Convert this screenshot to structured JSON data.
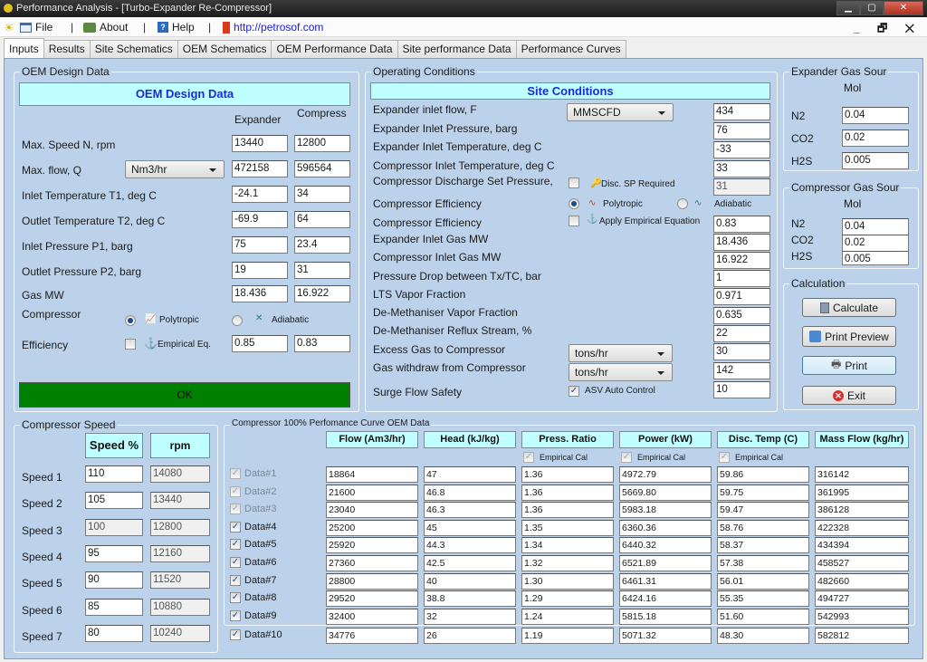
{
  "window": {
    "title": "Performance Analysis - [Turbo-Expander Re-Compressor]"
  },
  "menu": {
    "items": [
      {
        "label": "File",
        "icon": "window-icon"
      },
      {
        "label": "About",
        "icon": "about-icon"
      },
      {
        "label": "Help",
        "icon": "help-icon"
      },
      {
        "label": "http://petrosof.com",
        "icon": "bookmark-icon"
      }
    ],
    "separator": "|"
  },
  "tabs": [
    "Inputs",
    "Results",
    "Site Schematics",
    "OEM Schematics",
    "OEM Performance Data",
    "Site performance Data",
    "Performance Curves"
  ],
  "active_tab": "Inputs",
  "oem": {
    "group_label": "OEM Design Data",
    "header": "OEM Design Data",
    "col_expander": "Expander",
    "col_compress": "Compress",
    "flow_unit": "Nm3/hr",
    "rows": [
      {
        "label": "Max. Speed N, rpm",
        "expander": "13440",
        "compress": "12800"
      },
      {
        "label": "Max. flow, Q",
        "expander": "472158",
        "compress": "596564"
      },
      {
        "label": "Inlet Temperature T1, deg C",
        "expander": "-24.1",
        "compress": "34"
      },
      {
        "label": "Outlet Temperature T2, deg C",
        "expander": "-69.9",
        "compress": "64"
      },
      {
        "label": "Inlet Pressure P1, barg",
        "expander": "75",
        "compress": "23.4"
      },
      {
        "label": "Outlet Pressure P2, barg",
        "expander": "19",
        "compress": "31"
      },
      {
        "label": "Gas MW",
        "expander": "18.436",
        "compress": "16.922"
      }
    ],
    "compressor_label": "Compressor",
    "polytropic": "Polytropic",
    "adiabatic": "Adiabatic",
    "efficiency_label": "Efficiency",
    "empirical": "Empirical Eq.",
    "eff_expander": "0.85",
    "eff_compress": "0.83",
    "ok": "OK"
  },
  "site": {
    "group_label": "Operating Conditions",
    "header": "Site Conditions",
    "flow_unit": "MMSCFD",
    "rows": [
      {
        "label": "Expander inlet flow, F",
        "value": "434"
      },
      {
        "label": "Expander Inlet Pressure, barg",
        "value": "76"
      },
      {
        "label": "Expander Inlet Temperature, deg C",
        "value": "-33"
      },
      {
        "label": "Compressor Inlet Temperature, deg C",
        "value": "33"
      },
      {
        "label": "Compressor Discharge Set Pressure,",
        "value": "31"
      },
      {
        "label": "Compressor Efficiency",
        "value": ""
      },
      {
        "label": "Compressor Efficiency",
        "value": "0.83"
      },
      {
        "label": "Expander Inlet Gas MW",
        "value": "18.436"
      },
      {
        "label": "Compressor Inlet Gas MW",
        "value": "16.922"
      },
      {
        "label": "Pressure Drop between Tx/TC, bar",
        "value": "1"
      },
      {
        "label": "LTS Vapor Fraction",
        "value": "0.971"
      },
      {
        "label": "De-Methaniser Vapor Fraction",
        "value": "0.635"
      },
      {
        "label": "De-Methaniser Reflux Stream, %",
        "value": "22"
      },
      {
        "label": "Excess Gas to Compressor",
        "value": "30"
      },
      {
        "label": "Gas withdraw from Compressor",
        "value": "142"
      },
      {
        "label": "Surge Flow Safety",
        "value": "10"
      }
    ],
    "disc_sp": "Disc. SP Required",
    "polytropic": "Polytropic",
    "adiabatic": "Adiabatic",
    "apply_empirical": "Apply Empirical Equation",
    "excess_unit": "tons/hr",
    "withdraw_unit": "tons/hr",
    "asv": "ASV Auto Control"
  },
  "exp_sour": {
    "group_label": "Expander Gas Sour",
    "mol": "Mol",
    "n2_label": "N2",
    "n2": "0.04",
    "co2_label": "CO2",
    "co2": "0.02",
    "h2s_label": "H2S",
    "h2s": "0.005"
  },
  "comp_sour": {
    "group_label": "Compressor Gas Sour",
    "mol": "Mol",
    "n2_label": "N2",
    "n2": "0.04",
    "co2_label": "CO2",
    "co2": "0.02",
    "h2s_label": "H2S",
    "h2s": "0.005"
  },
  "calc": {
    "group_label": "Calculation",
    "calculate": "Calculate",
    "print_preview": "Print Preview",
    "print": "Print",
    "exit": "Exit"
  },
  "speed": {
    "group_label": "Compressor Speed",
    "col_pct": "Speed %",
    "col_rpm": "rpm",
    "rows": [
      {
        "label": "Speed 1",
        "pct": "110",
        "rpm": "14080"
      },
      {
        "label": "Speed 2",
        "pct": "105",
        "rpm": "13440"
      },
      {
        "label": "Speed 3",
        "pct": "100",
        "rpm": "12800"
      },
      {
        "label": "Speed 4",
        "pct": "95",
        "rpm": "12160"
      },
      {
        "label": "Speed 5",
        "pct": "90",
        "rpm": "11520"
      },
      {
        "label": "Speed 6",
        "pct": "85",
        "rpm": "10880"
      },
      {
        "label": "Speed 7",
        "pct": "80",
        "rpm": "10240"
      }
    ]
  },
  "curve": {
    "group_label": "Compressor 100% Perfomance Curve OEM Data",
    "headers": [
      "Flow (Am3/hr)",
      "Head (kJ/kg)",
      "Press. Ratio",
      "Power (kW)",
      "Disc. Temp (C)",
      "Mass Flow (kg/hr)"
    ],
    "empirical": "Empirical Cal",
    "rows": [
      {
        "label": "Data#1",
        "enabled": false,
        "flow": "18864",
        "head": "47",
        "pr": "1.36",
        "power": "4972.79",
        "temp": "59.86",
        "mass": "316142"
      },
      {
        "label": "Data#2",
        "enabled": false,
        "flow": "21600",
        "head": "46.8",
        "pr": "1.36",
        "power": "5669.80",
        "temp": "59.75",
        "mass": "361995"
      },
      {
        "label": "Data#3",
        "enabled": false,
        "flow": "23040",
        "head": "46.3",
        "pr": "1.36",
        "power": "5983.18",
        "temp": "59.47",
        "mass": "386128"
      },
      {
        "label": "Data#4",
        "enabled": true,
        "flow": "25200",
        "head": "45",
        "pr": "1.35",
        "power": "6360.36",
        "temp": "58.76",
        "mass": "422328"
      },
      {
        "label": "Data#5",
        "enabled": true,
        "flow": "25920",
        "head": "44.3",
        "pr": "1.34",
        "power": "6440.32",
        "temp": "58.37",
        "mass": "434394"
      },
      {
        "label": "Data#6",
        "enabled": true,
        "flow": "27360",
        "head": "42.5",
        "pr": "1.32",
        "power": "6521.89",
        "temp": "57.38",
        "mass": "458527"
      },
      {
        "label": "Data#7",
        "enabled": true,
        "flow": "28800",
        "head": "40",
        "pr": "1.30",
        "power": "6461.31",
        "temp": "56.01",
        "mass": "482660"
      },
      {
        "label": "Data#8",
        "enabled": true,
        "flow": "29520",
        "head": "38.8",
        "pr": "1.29",
        "power": "6424.16",
        "temp": "55.35",
        "mass": "494727"
      },
      {
        "label": "Data#9",
        "enabled": true,
        "flow": "32400",
        "head": "32",
        "pr": "1.24",
        "power": "5815.18",
        "temp": "51.60",
        "mass": "542993"
      },
      {
        "label": "Data#10",
        "enabled": true,
        "flow": "34776",
        "head": "26",
        "pr": "1.19",
        "power": "5071.32",
        "temp": "48.30",
        "mass": "582812"
      }
    ]
  },
  "colors": {
    "panel": "#bcd2ea",
    "header_bg": "#bfffff",
    "header_text": "#1b2bd8",
    "ok_green": "#008000"
  }
}
